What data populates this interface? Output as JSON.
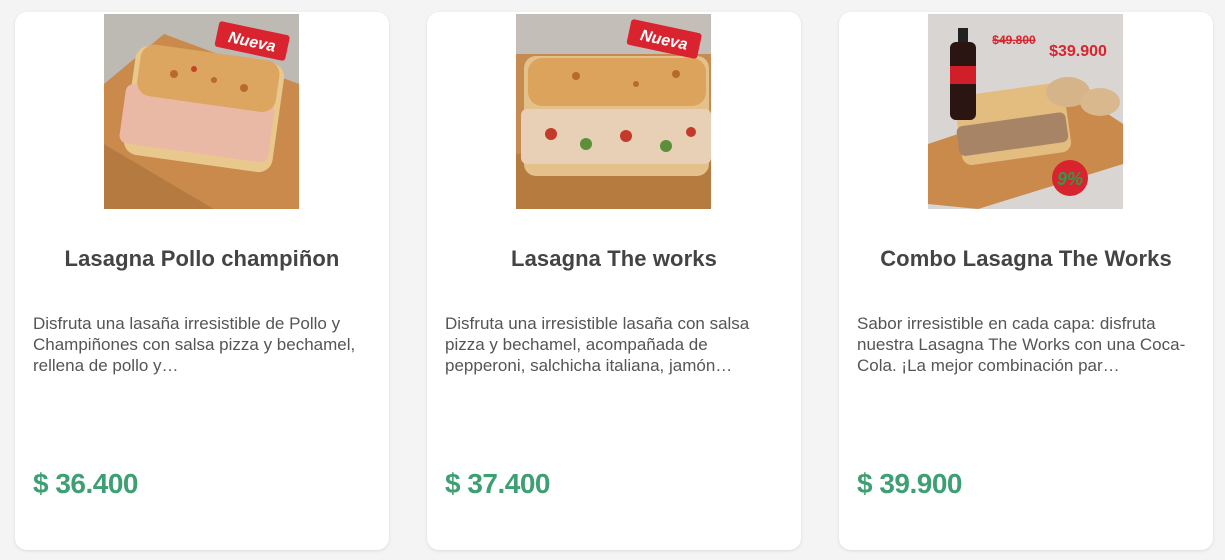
{
  "products": [
    {
      "title": "Lasagna Pollo champiñon",
      "description": "Disfruta una lasaña irresistible de Pollo y Champiñones con salsa pizza y bechamel, rellena de pollo y…",
      "price": "$ 36.400",
      "badge": "Nueva"
    },
    {
      "title": "Lasagna The works",
      "description": "Disfruta una irresistible lasaña con salsa pizza y bechamel, acompañada de pepperoni, salchicha italiana, jamón…",
      "price": "$ 37.400",
      "badge": "Nueva"
    },
    {
      "title": "Combo Lasagna The Works",
      "description": "Sabor irresistible en cada capa: disfruta nuestra Lasagna The Works con una Coca-Cola. ¡La mejor combinación par…",
      "price": "$ 39.900",
      "old_price": "$49.800",
      "new_price": "$39.900",
      "discount": "9%"
    }
  ],
  "colors": {
    "price": "#3e9f73",
    "title": "#444444",
    "badge": "#d9232e"
  }
}
